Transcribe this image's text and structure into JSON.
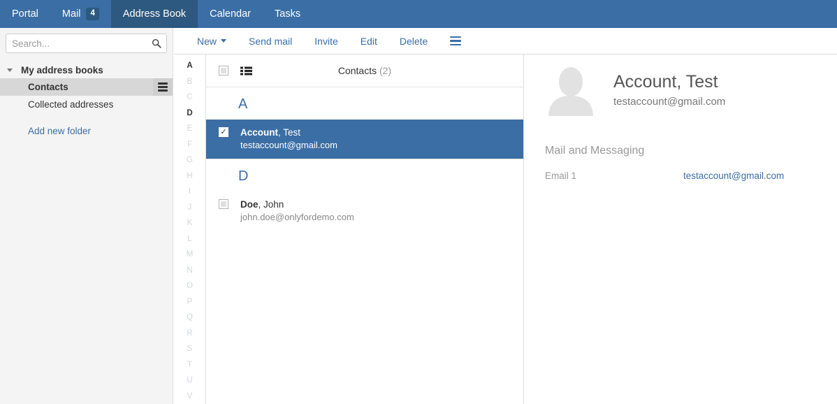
{
  "topnav": {
    "tabs": [
      {
        "label": "Portal",
        "active": false,
        "badge": null
      },
      {
        "label": "Mail",
        "active": false,
        "badge": "4"
      },
      {
        "label": "Address Book",
        "active": true,
        "badge": null
      },
      {
        "label": "Calendar",
        "active": false,
        "badge": null
      },
      {
        "label": "Tasks",
        "active": false,
        "badge": null
      }
    ]
  },
  "sidebar": {
    "search": {
      "value": "",
      "placeholder": "Search...",
      "icon": "search-icon"
    },
    "group_label": "My address books",
    "items": [
      {
        "label": "Contacts",
        "selected": true
      },
      {
        "label": "Collected addresses",
        "selected": false
      }
    ],
    "add_new_label": "Add new folder",
    "menu_icon": "hamburger-icon"
  },
  "toolbar": {
    "new_label": "New",
    "send_mail_label": "Send mail",
    "invite_label": "Invite",
    "edit_label": "Edit",
    "delete_label": "Delete",
    "options_icon": "hamburger-icon"
  },
  "alphabet": {
    "letters": [
      "A",
      "B",
      "C",
      "D",
      "E",
      "F",
      "G",
      "H",
      "I",
      "J",
      "K",
      "L",
      "M",
      "N",
      "O",
      "P",
      "Q",
      "R",
      "S",
      "T",
      "U",
      "V"
    ],
    "active": [
      "A",
      "D"
    ]
  },
  "list": {
    "title": "Contacts",
    "count": "(2)",
    "select_all_checked": false,
    "view_icon": "list-view-icon",
    "groups": [
      {
        "letter": "A",
        "contacts": [
          {
            "last_name": "Account",
            "first_name": ", Test",
            "email": "testaccount@gmail.com",
            "selected": true,
            "checked": true
          }
        ]
      },
      {
        "letter": "D",
        "contacts": [
          {
            "last_name": "Doe",
            "first_name": ", John",
            "email": "john.doe@onlyfordemo.com",
            "selected": false,
            "checked": false
          }
        ]
      }
    ]
  },
  "detail": {
    "avatar_icon": "avatar-placeholder-icon",
    "name": "Account, Test",
    "email": "testaccount@gmail.com",
    "section_title": "Mail and Messaging",
    "fields": [
      {
        "label": "Email 1",
        "value": "testaccount@gmail.com"
      }
    ]
  },
  "colors": {
    "nav_blue": "#3a6ea5",
    "nav_active_blue": "#2d587f",
    "accent_blue": "#3a6ea5",
    "sidebar_bg": "#f4f4f4",
    "selected_folder_bg": "#d7d7d7"
  }
}
